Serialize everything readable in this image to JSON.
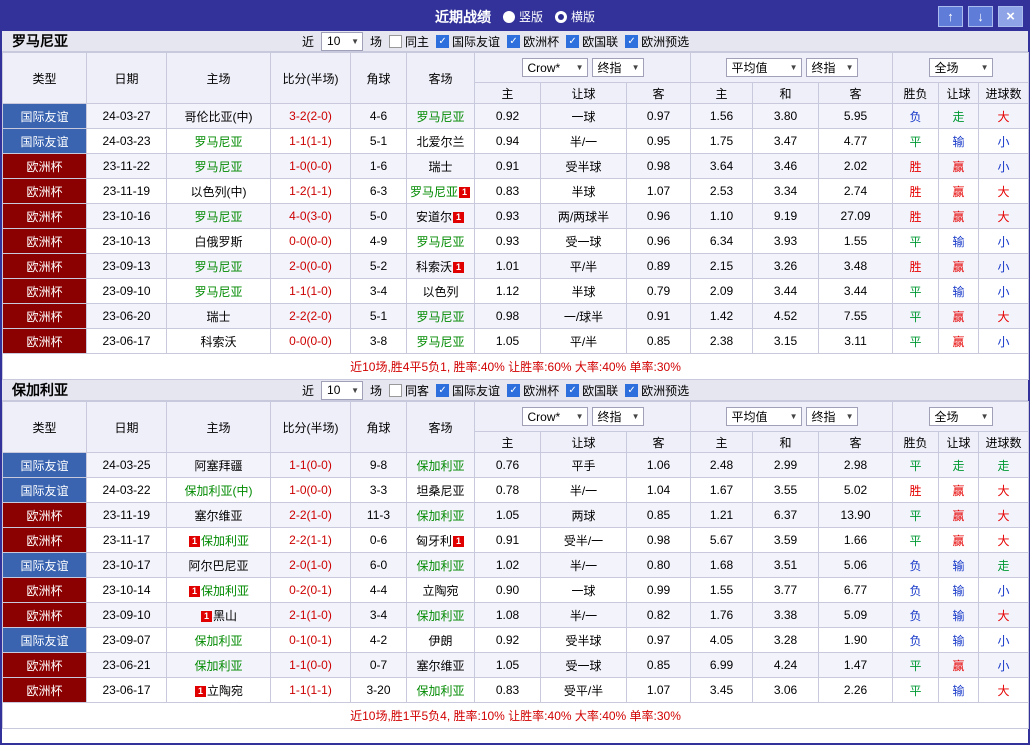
{
  "colors": {
    "frame": "#32329A",
    "button_blue": "#5E7CD8",
    "close_button_blue": "#8FA4E6",
    "team_bar_bg": "#E6E6F0",
    "header_bg": "#EFEFF9",
    "row_alt_bg": "#F3F3FB",
    "grid_line": "#C9C9DE",
    "friendly_bg": "#3A64B0",
    "eurocup_bg": "#8B0000",
    "team_green": "#008A00",
    "score_red": "#CC0000",
    "result_win_red": "#E60000",
    "result_draw_green": "#009933",
    "result_loss_blue": "#1638C8",
    "summary_red": "#D10000",
    "red_card_badge": "#E00000",
    "checkbox_blue": "#2D6FDD"
  },
  "titlebar": {
    "title": "近期战绩",
    "vertical_label": "竖版",
    "horizontal_label": "横版",
    "selected_layout": "横版",
    "up_glyph": "↑",
    "down_glyph": "↓",
    "close_glyph": "×"
  },
  "filter_labels": {
    "near": "近",
    "games": "场"
  },
  "columns": {
    "main": [
      "类型",
      "日期",
      "主场",
      "比分(半场)",
      "角球",
      "客场"
    ],
    "bookmaker": "Crow*",
    "final_index": "终指",
    "average": "平均值",
    "fulltime": "全场",
    "sub": [
      "主",
      "让球",
      "客",
      "主",
      "和",
      "客",
      "胜负",
      "让球",
      "进球数"
    ]
  },
  "sections": [
    {
      "team": "罗马尼亚",
      "games_count": "10",
      "same_venue": "同主",
      "competitions": [
        "国际友谊",
        "欧洲杯",
        "欧国联",
        "欧洲预选"
      ],
      "rows": [
        {
          "t": "国际友谊",
          "tc": "f",
          "d": "24-03-27",
          "h": "哥伦比亚(中)",
          "hg": 0,
          "hb": 0,
          "s": "3-2(2-0)",
          "c": "4-6",
          "a": "罗马尼亚",
          "ag": 1,
          "ab": 0,
          "o1": [
            "0.92",
            "一球",
            "0.97"
          ],
          "o2": [
            "1.56",
            "3.80",
            "5.95"
          ],
          "r": [
            "负",
            "走",
            "大"
          ],
          "rc": [
            "b",
            "g",
            "r"
          ]
        },
        {
          "t": "国际友谊",
          "tc": "f",
          "d": "24-03-23",
          "h": "罗马尼亚",
          "hg": 1,
          "hb": 0,
          "s": "1-1(1-1)",
          "c": "5-1",
          "a": "北爱尔兰",
          "ag": 0,
          "ab": 0,
          "o1": [
            "0.94",
            "半/一",
            "0.95"
          ],
          "o2": [
            "1.75",
            "3.47",
            "4.77"
          ],
          "r": [
            "平",
            "输",
            "小"
          ],
          "rc": [
            "g",
            "b",
            "b"
          ]
        },
        {
          "t": "欧洲杯",
          "tc": "e",
          "d": "23-11-22",
          "h": "罗马尼亚",
          "hg": 1,
          "hb": 0,
          "s": "1-0(0-0)",
          "c": "1-6",
          "a": "瑞士",
          "ag": 0,
          "ab": 0,
          "o1": [
            "0.91",
            "受半球",
            "0.98"
          ],
          "o2": [
            "3.64",
            "3.46",
            "2.02"
          ],
          "r": [
            "胜",
            "赢",
            "小"
          ],
          "rc": [
            "r",
            "r",
            "b"
          ]
        },
        {
          "t": "欧洲杯",
          "tc": "e",
          "d": "23-11-19",
          "h": "以色列(中)",
          "hg": 0,
          "hb": 0,
          "s": "1-2(1-1)",
          "c": "6-3",
          "a": "罗马尼亚",
          "ag": 1,
          "ab": 1,
          "o1": [
            "0.83",
            "半球",
            "1.07"
          ],
          "o2": [
            "2.53",
            "3.34",
            "2.74"
          ],
          "r": [
            "胜",
            "赢",
            "大"
          ],
          "rc": [
            "r",
            "r",
            "r"
          ]
        },
        {
          "t": "欧洲杯",
          "tc": "e",
          "d": "23-10-16",
          "h": "罗马尼亚",
          "hg": 1,
          "hb": 0,
          "s": "4-0(3-0)",
          "c": "5-0",
          "a": "安道尔",
          "ag": 0,
          "ab": 1,
          "o1": [
            "0.93",
            "两/两球半",
            "0.96"
          ],
          "o2": [
            "1.10",
            "9.19",
            "27.09"
          ],
          "r": [
            "胜",
            "赢",
            "大"
          ],
          "rc": [
            "r",
            "r",
            "r"
          ]
        },
        {
          "t": "欧洲杯",
          "tc": "e",
          "d": "23-10-13",
          "h": "白俄罗斯",
          "hg": 0,
          "hb": 0,
          "s": "0-0(0-0)",
          "c": "4-9",
          "a": "罗马尼亚",
          "ag": 1,
          "ab": 0,
          "o1": [
            "0.93",
            "受一球",
            "0.96"
          ],
          "o2": [
            "6.34",
            "3.93",
            "1.55"
          ],
          "r": [
            "平",
            "输",
            "小"
          ],
          "rc": [
            "g",
            "b",
            "b"
          ]
        },
        {
          "t": "欧洲杯",
          "tc": "e",
          "d": "23-09-13",
          "h": "罗马尼亚",
          "hg": 1,
          "hb": 0,
          "s": "2-0(0-0)",
          "c": "5-2",
          "a": "科索沃",
          "ag": 0,
          "ab": 1,
          "o1": [
            "1.01",
            "平/半",
            "0.89"
          ],
          "o2": [
            "2.15",
            "3.26",
            "3.48"
          ],
          "r": [
            "胜",
            "赢",
            "小"
          ],
          "rc": [
            "r",
            "r",
            "b"
          ]
        },
        {
          "t": "欧洲杯",
          "tc": "e",
          "d": "23-09-10",
          "h": "罗马尼亚",
          "hg": 1,
          "hb": 0,
          "s": "1-1(1-0)",
          "c": "3-4",
          "a": "以色列",
          "ag": 0,
          "ab": 0,
          "o1": [
            "1.12",
            "半球",
            "0.79"
          ],
          "o2": [
            "2.09",
            "3.44",
            "3.44"
          ],
          "r": [
            "平",
            "输",
            "小"
          ],
          "rc": [
            "g",
            "b",
            "b"
          ]
        },
        {
          "t": "欧洲杯",
          "tc": "e",
          "d": "23-06-20",
          "h": "瑞士",
          "hg": 0,
          "hb": 0,
          "s": "2-2(2-0)",
          "c": "5-1",
          "a": "罗马尼亚",
          "ag": 1,
          "ab": 0,
          "o1": [
            "0.98",
            "一/球半",
            "0.91"
          ],
          "o2": [
            "1.42",
            "4.52",
            "7.55"
          ],
          "r": [
            "平",
            "赢",
            "大"
          ],
          "rc": [
            "g",
            "r",
            "r"
          ]
        },
        {
          "t": "欧洲杯",
          "tc": "e",
          "d": "23-06-17",
          "h": "科索沃",
          "hg": 0,
          "hb": 0,
          "s": "0-0(0-0)",
          "c": "3-8",
          "a": "罗马尼亚",
          "ag": 1,
          "ab": 0,
          "o1": [
            "1.05",
            "平/半",
            "0.85"
          ],
          "o2": [
            "2.38",
            "3.15",
            "3.11"
          ],
          "r": [
            "平",
            "赢",
            "小"
          ],
          "rc": [
            "g",
            "r",
            "b"
          ]
        }
      ],
      "summary": "近10场,胜4平5负1, 胜率:40% 让胜率:60% 大率:40% 单率:30%"
    },
    {
      "team": "保加利亚",
      "games_count": "10",
      "same_venue": "同客",
      "competitions": [
        "国际友谊",
        "欧洲杯",
        "欧国联",
        "欧洲预选"
      ],
      "rows": [
        {
          "t": "国际友谊",
          "tc": "f",
          "d": "24-03-25",
          "h": "阿塞拜疆",
          "hg": 0,
          "hb": 0,
          "s": "1-1(0-0)",
          "c": "9-8",
          "a": "保加利亚",
          "ag": 1,
          "ab": 0,
          "o1": [
            "0.76",
            "平手",
            "1.06"
          ],
          "o2": [
            "2.48",
            "2.99",
            "2.98"
          ],
          "r": [
            "平",
            "走",
            "走"
          ],
          "rc": [
            "g",
            "g",
            "g"
          ]
        },
        {
          "t": "国际友谊",
          "tc": "f",
          "d": "24-03-22",
          "h": "保加利亚(中)",
          "hg": 1,
          "hb": 0,
          "s": "1-0(0-0)",
          "c": "3-3",
          "a": "坦桑尼亚",
          "ag": 0,
          "ab": 0,
          "o1": [
            "0.78",
            "半/一",
            "1.04"
          ],
          "o2": [
            "1.67",
            "3.55",
            "5.02"
          ],
          "r": [
            "胜",
            "赢",
            "大"
          ],
          "rc": [
            "r",
            "r",
            "r"
          ]
        },
        {
          "t": "欧洲杯",
          "tc": "e",
          "d": "23-11-19",
          "h": "塞尔维亚",
          "hg": 0,
          "hb": 0,
          "s": "2-2(1-0)",
          "c": "11-3",
          "a": "保加利亚",
          "ag": 1,
          "ab": 0,
          "o1": [
            "1.05",
            "两球",
            "0.85"
          ],
          "o2": [
            "1.21",
            "6.37",
            "13.90"
          ],
          "r": [
            "平",
            "赢",
            "大"
          ],
          "rc": [
            "g",
            "r",
            "r"
          ]
        },
        {
          "t": "欧洲杯",
          "tc": "e",
          "d": "23-11-17",
          "h": "保加利亚",
          "hg": 1,
          "hb": 1,
          "s": "2-2(1-1)",
          "c": "0-6",
          "a": "匈牙利",
          "ag": 0,
          "ab": 1,
          "o1": [
            "0.91",
            "受半/一",
            "0.98"
          ],
          "o2": [
            "5.67",
            "3.59",
            "1.66"
          ],
          "r": [
            "平",
            "赢",
            "大"
          ],
          "rc": [
            "g",
            "r",
            "r"
          ]
        },
        {
          "t": "国际友谊",
          "tc": "f",
          "d": "23-10-17",
          "h": "阿尔巴尼亚",
          "hg": 0,
          "hb": 0,
          "s": "2-0(1-0)",
          "c": "6-0",
          "a": "保加利亚",
          "ag": 1,
          "ab": 0,
          "o1": [
            "1.02",
            "半/一",
            "0.80"
          ],
          "o2": [
            "1.68",
            "3.51",
            "5.06"
          ],
          "r": [
            "负",
            "输",
            "走"
          ],
          "rc": [
            "b",
            "b",
            "g"
          ]
        },
        {
          "t": "欧洲杯",
          "tc": "e",
          "d": "23-10-14",
          "h": "保加利亚",
          "hg": 1,
          "hb": 1,
          "s": "0-2(0-1)",
          "c": "4-4",
          "a": "立陶宛",
          "ag": 0,
          "ab": 0,
          "o1": [
            "0.90",
            "一球",
            "0.99"
          ],
          "o2": [
            "1.55",
            "3.77",
            "6.77"
          ],
          "r": [
            "负",
            "输",
            "小"
          ],
          "rc": [
            "b",
            "b",
            "b"
          ]
        },
        {
          "t": "欧洲杯",
          "tc": "e",
          "d": "23-09-10",
          "h": "黑山",
          "hg": 0,
          "hb": 1,
          "s": "2-1(1-0)",
          "c": "3-4",
          "a": "保加利亚",
          "ag": 1,
          "ab": 0,
          "o1": [
            "1.08",
            "半/一",
            "0.82"
          ],
          "o2": [
            "1.76",
            "3.38",
            "5.09"
          ],
          "r": [
            "负",
            "输",
            "大"
          ],
          "rc": [
            "b",
            "b",
            "r"
          ]
        },
        {
          "t": "国际友谊",
          "tc": "f",
          "d": "23-09-07",
          "h": "保加利亚",
          "hg": 1,
          "hb": 0,
          "s": "0-1(0-1)",
          "c": "4-2",
          "a": "伊朗",
          "ag": 0,
          "ab": 0,
          "o1": [
            "0.92",
            "受半球",
            "0.97"
          ],
          "o2": [
            "4.05",
            "3.28",
            "1.90"
          ],
          "r": [
            "负",
            "输",
            "小"
          ],
          "rc": [
            "b",
            "b",
            "b"
          ]
        },
        {
          "t": "欧洲杯",
          "tc": "e",
          "d": "23-06-21",
          "h": "保加利亚",
          "hg": 1,
          "hb": 0,
          "s": "1-1(0-0)",
          "c": "0-7",
          "a": "塞尔维亚",
          "ag": 0,
          "ab": 0,
          "o1": [
            "1.05",
            "受一球",
            "0.85"
          ],
          "o2": [
            "6.99",
            "4.24",
            "1.47"
          ],
          "r": [
            "平",
            "赢",
            "小"
          ],
          "rc": [
            "g",
            "r",
            "b"
          ]
        },
        {
          "t": "欧洲杯",
          "tc": "e",
          "d": "23-06-17",
          "h": "立陶宛",
          "hg": 0,
          "hb": 1,
          "s": "1-1(1-1)",
          "c": "3-20",
          "a": "保加利亚",
          "ag": 1,
          "ab": 0,
          "o1": [
            "0.83",
            "受平/半",
            "1.07"
          ],
          "o2": [
            "3.45",
            "3.06",
            "2.26"
          ],
          "r": [
            "平",
            "输",
            "大"
          ],
          "rc": [
            "g",
            "b",
            "r"
          ]
        }
      ],
      "summary": "近10场,胜1平5负4, 胜率:10% 让胜率:40% 大率:40% 单率:30%"
    }
  ]
}
